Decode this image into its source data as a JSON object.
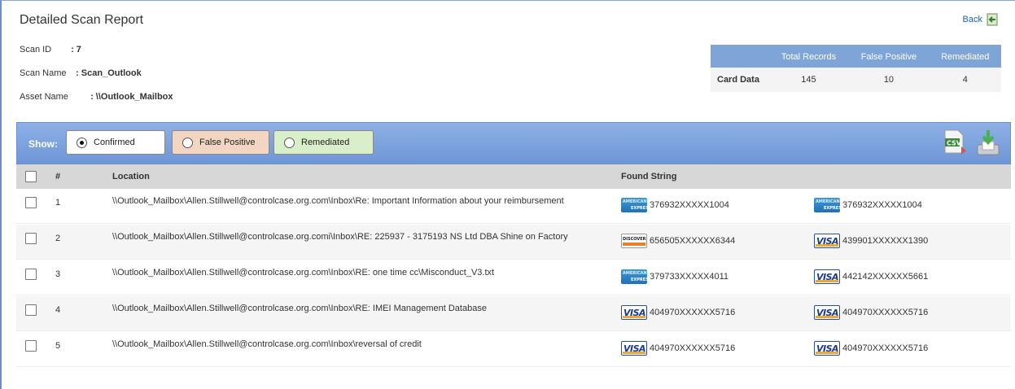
{
  "page": {
    "title": "Detailed Scan Report",
    "back_label": "Back"
  },
  "meta": {
    "scan_id_label": "Scan ID",
    "scan_id_value": ": 7",
    "scan_name_label": "Scan Name",
    "scan_name_value": ": Scan_Outlook",
    "asset_name_label": "Asset Name",
    "asset_name_value": ": \\\\Outlook_Mailbox"
  },
  "summary": {
    "headers": [
      "Total Records",
      "False Positive",
      "Remediated"
    ],
    "row_label": "Card Data",
    "values": [
      "145",
      "10",
      "4"
    ]
  },
  "filter": {
    "show_label": "Show:",
    "options": [
      "Confirmed",
      "False Positive",
      "Remediated"
    ],
    "selected": "Confirmed",
    "colors": {
      "confirmed": "#ffffff",
      "false_positive": "#f3d6c2",
      "remediated": "#d8efc9",
      "bar": "#7fa4d8"
    }
  },
  "grid": {
    "headers": {
      "num": "#",
      "location": "Location",
      "found": "Found String"
    },
    "rows": [
      {
        "num": "1",
        "location": "\\\\Outlook_Mailbox\\Allen.Stillwell@controlcase.org.com\\Inbox\\Re: Important Information about your reimbursement",
        "found": [
          {
            "card": "amex-icon",
            "value": "376932XXXXX1004"
          },
          {
            "card": "amex-icon",
            "value": "376932XXXXX1004"
          }
        ]
      },
      {
        "num": "2",
        "location": "\\\\Outlook_Mailbox\\Allen.Stillwell@controlcase.org.comi\\Inbox\\RE: 225937 - 3175193 NS Ltd DBA Shine on Factory",
        "found": [
          {
            "card": "discover-icon",
            "value": "656505XXXXXX6344"
          },
          {
            "card": "visa-icon",
            "value": "439901XXXXXX1390"
          }
        ]
      },
      {
        "num": "3",
        "location": "\\\\Outlook_Mailbox\\Allen.Stillwell@controlcase.org.com\\Inbox\\RE: one time cc\\Misconduct_V3.txt",
        "found": [
          {
            "card": "amex-icon",
            "value": "379733XXXXX4011"
          },
          {
            "card": "visa-icon",
            "value": "442142XXXXXX5661"
          }
        ]
      },
      {
        "num": "4",
        "location": "\\\\Outlook_Mailbox\\Allen.Stillwell@controlcase.org.com\\Inbox\\RE: IMEI Management Database",
        "found": [
          {
            "card": "visa-icon",
            "value": "404970XXXXXX5716"
          },
          {
            "card": "visa-icon",
            "value": "404970XXXXXX5716"
          }
        ]
      },
      {
        "num": "5",
        "location": "\\\\Outlook_Mailbox\\Allen.Stillwell@controlcase.org.com\\Inbox\\reversal of credit",
        "found": [
          {
            "card": "visa-icon",
            "value": "404970XXXXXX5716"
          },
          {
            "card": "visa-icon",
            "value": "404970XXXXXX5716"
          }
        ]
      }
    ]
  }
}
